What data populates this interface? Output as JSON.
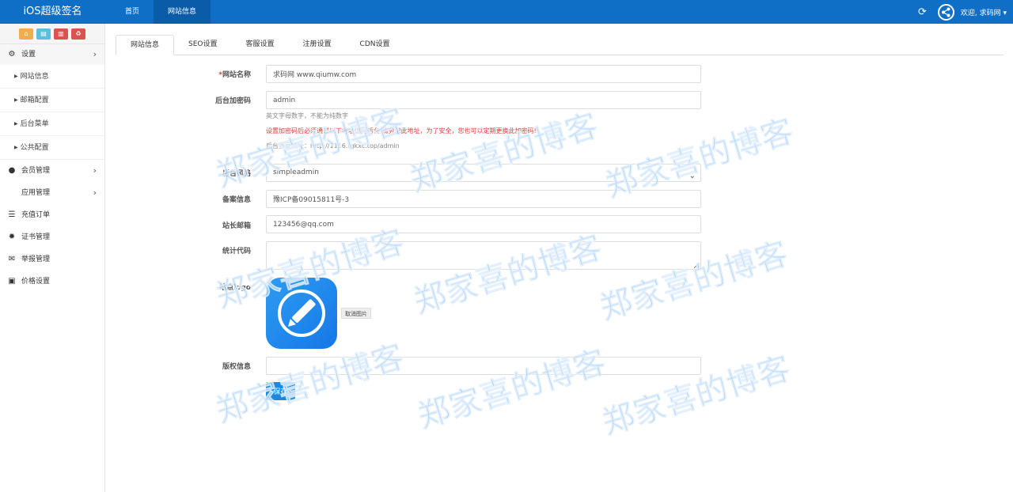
{
  "header": {
    "brand": "iOS超级签名",
    "nav": [
      {
        "label": "首页"
      },
      {
        "label": "网站信息"
      }
    ],
    "user_menu": "欢迎, 求码网 ▾"
  },
  "sidebar": {
    "items": [
      {
        "label": "设置",
        "icon": "gears-icon"
      },
      {
        "label": "网站信息"
      },
      {
        "label": "邮箱配置"
      },
      {
        "label": "后台菜单"
      },
      {
        "label": "公共配置"
      },
      {
        "label": "会员管理",
        "icon": "user-icon"
      },
      {
        "label": "应用管理",
        "icon": "apple-icon"
      },
      {
        "label": "充值订单",
        "icon": "list-icon"
      },
      {
        "label": "证书管理",
        "icon": "certificate-icon"
      },
      {
        "label": "举报管理",
        "icon": "envelope-icon"
      },
      {
        "label": "价格设置",
        "icon": "money-icon"
      }
    ]
  },
  "tabs": [
    {
      "label": "网站信息"
    },
    {
      "label": "SEO设置"
    },
    {
      "label": "客服设置"
    },
    {
      "label": "注册设置"
    },
    {
      "label": "CDN设置"
    }
  ],
  "form": {
    "site_name": {
      "label": "网站名称",
      "required_mark": "*",
      "value": "求码网 www.qiumw.com"
    },
    "admin_code": {
      "label": "后台加密码",
      "value": "admin",
      "help1": "英文字母数字，不能为纯数字",
      "help2": "设置加密码后必须通过以下地址访问后台,请劳记此地址，为了安全，您也可以定期更换此加密码!",
      "help3": "后台登录地址：http://1116.rgkxc.top/admin"
    },
    "theme": {
      "label": "后台风格",
      "value": "simpleadmin"
    },
    "icp": {
      "label": "备案信息",
      "value": "豫ICP备09015811号-3"
    },
    "email": {
      "label": "站长邮箱",
      "value": "123456@qq.com"
    },
    "stats_code": {
      "label": "统计代码",
      "value": ""
    },
    "logo": {
      "label": "站点logo",
      "cancel_label": "取消图片",
      "icon": "pencil-icon"
    },
    "copyright": {
      "label": "版权信息",
      "value": ""
    },
    "save_label": "保存"
  },
  "watermark": "郑家喜的博客",
  "colors": {
    "topbar": "#0f6fc6",
    "accent": "#1a8ae0",
    "required": "#e4393c"
  }
}
